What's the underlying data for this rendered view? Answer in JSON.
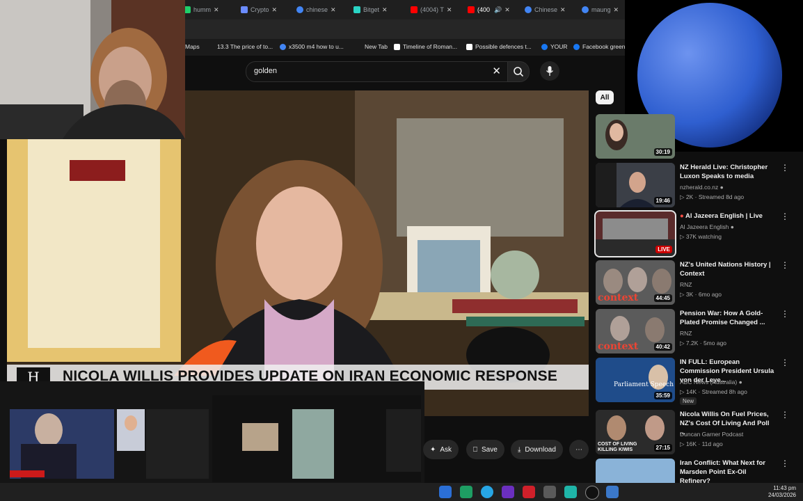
{
  "tabs": [
    {
      "title": "humm",
      "color": "#1fcf6a"
    },
    {
      "title": "Crypto",
      "color": "#6b8cff"
    },
    {
      "title": "chinese",
      "color": "#4285f4"
    },
    {
      "title": "Bitget",
      "color": "#2ad4c4"
    },
    {
      "title": "(4004) T",
      "color": "#ff0000"
    },
    {
      "title": "(400",
      "color": "#ff0000"
    },
    {
      "title": "Chinese",
      "color": "#4285f4"
    },
    {
      "title": "maung",
      "color": "#4285f4"
    }
  ],
  "bookmarks": [
    {
      "label": "Maps",
      "color": "#34a853"
    },
    {
      "label": "13.3 The price of to...",
      "color": ""
    },
    {
      "label": "x3500 m4 how to u...",
      "color": "#4285f4"
    },
    {
      "label": "New Tab",
      "color": ""
    },
    {
      "label": "Timeline of Roman...",
      "color": "#ffffff"
    },
    {
      "label": "Possible defences t...",
      "color": "#ffffff"
    },
    {
      "label": "YOUR",
      "color": "#1877f2"
    },
    {
      "label": "Facebook green",
      "color": "#1877f2"
    }
  ],
  "search": {
    "query": "golden"
  },
  "video": {
    "caption": "NICOLA WILLIS PROVIDES UPDATE ON IRAN ECONOMIC RESPONSE",
    "logo": "H"
  },
  "actions": {
    "ask": "Ask",
    "save": "Save",
    "download": "Download"
  },
  "chips": {
    "all": "All"
  },
  "recommendations": [
    {
      "title": "",
      "channel": "",
      "meta": "",
      "duration": "30:19",
      "thumb": "#4a3a3a"
    },
    {
      "title": "NZ Herald Live: Christopher Luxon Speaks to media",
      "channel": "nzherald.co.nz",
      "meta": "2K · Streamed 8d ago",
      "duration": "19:46",
      "thumb": "#3b3f47",
      "verified": true
    },
    {
      "title": "Al Jazeera English | Live",
      "channel": "Al Jazeera English",
      "meta": "37K watching",
      "duration": "LIVE",
      "thumb": "#5a2b2b",
      "live": true,
      "verified": true
    },
    {
      "title": "NZ's United Nations History | Context",
      "channel": "RNZ",
      "meta": "3K · 6mo ago",
      "duration": "44:45",
      "thumb": "#4b4b4b",
      "thumbtext": "context"
    },
    {
      "title": "Pension War: How A Gold-Plated Promise Changed ...",
      "channel": "RNZ",
      "meta": "7.2K · 5mo ago",
      "duration": "40:42",
      "thumb": "#4b4b4b",
      "thumbtext": "context"
    },
    {
      "title": "IN FULL: European Commission President Ursula von der Leye...",
      "channel": "ABC News (Australia)",
      "meta": "14K · Streamed 8h ago",
      "duration": "35:59",
      "thumb": "#1f4c8a",
      "thumbtext": "Parliament Speech",
      "badge": "New",
      "verified": true
    },
    {
      "title": "Nicola Willis On Fuel Prices, NZ's Cost Of Living And Poll ...",
      "channel": "Duncan Garner Podcast",
      "meta": "16K · 11d ago",
      "duration": "27:15",
      "thumb": "#2b2b2b",
      "thumbtext": "COST OF LIVING KILLING KIWIS"
    },
    {
      "title": "Iran Conflict: What Next for Marsden Point Ex-Oil Refinery?",
      "channel": "",
      "meta": "",
      "duration": "",
      "thumb": "#8ab3d8"
    }
  ],
  "taskbar": {
    "time": "11:43 pm",
    "date": "24/03/2026"
  },
  "colors": {
    "accent": "#ff0000",
    "bg": "#0f0f0f",
    "planet": "#2f5fd0"
  }
}
